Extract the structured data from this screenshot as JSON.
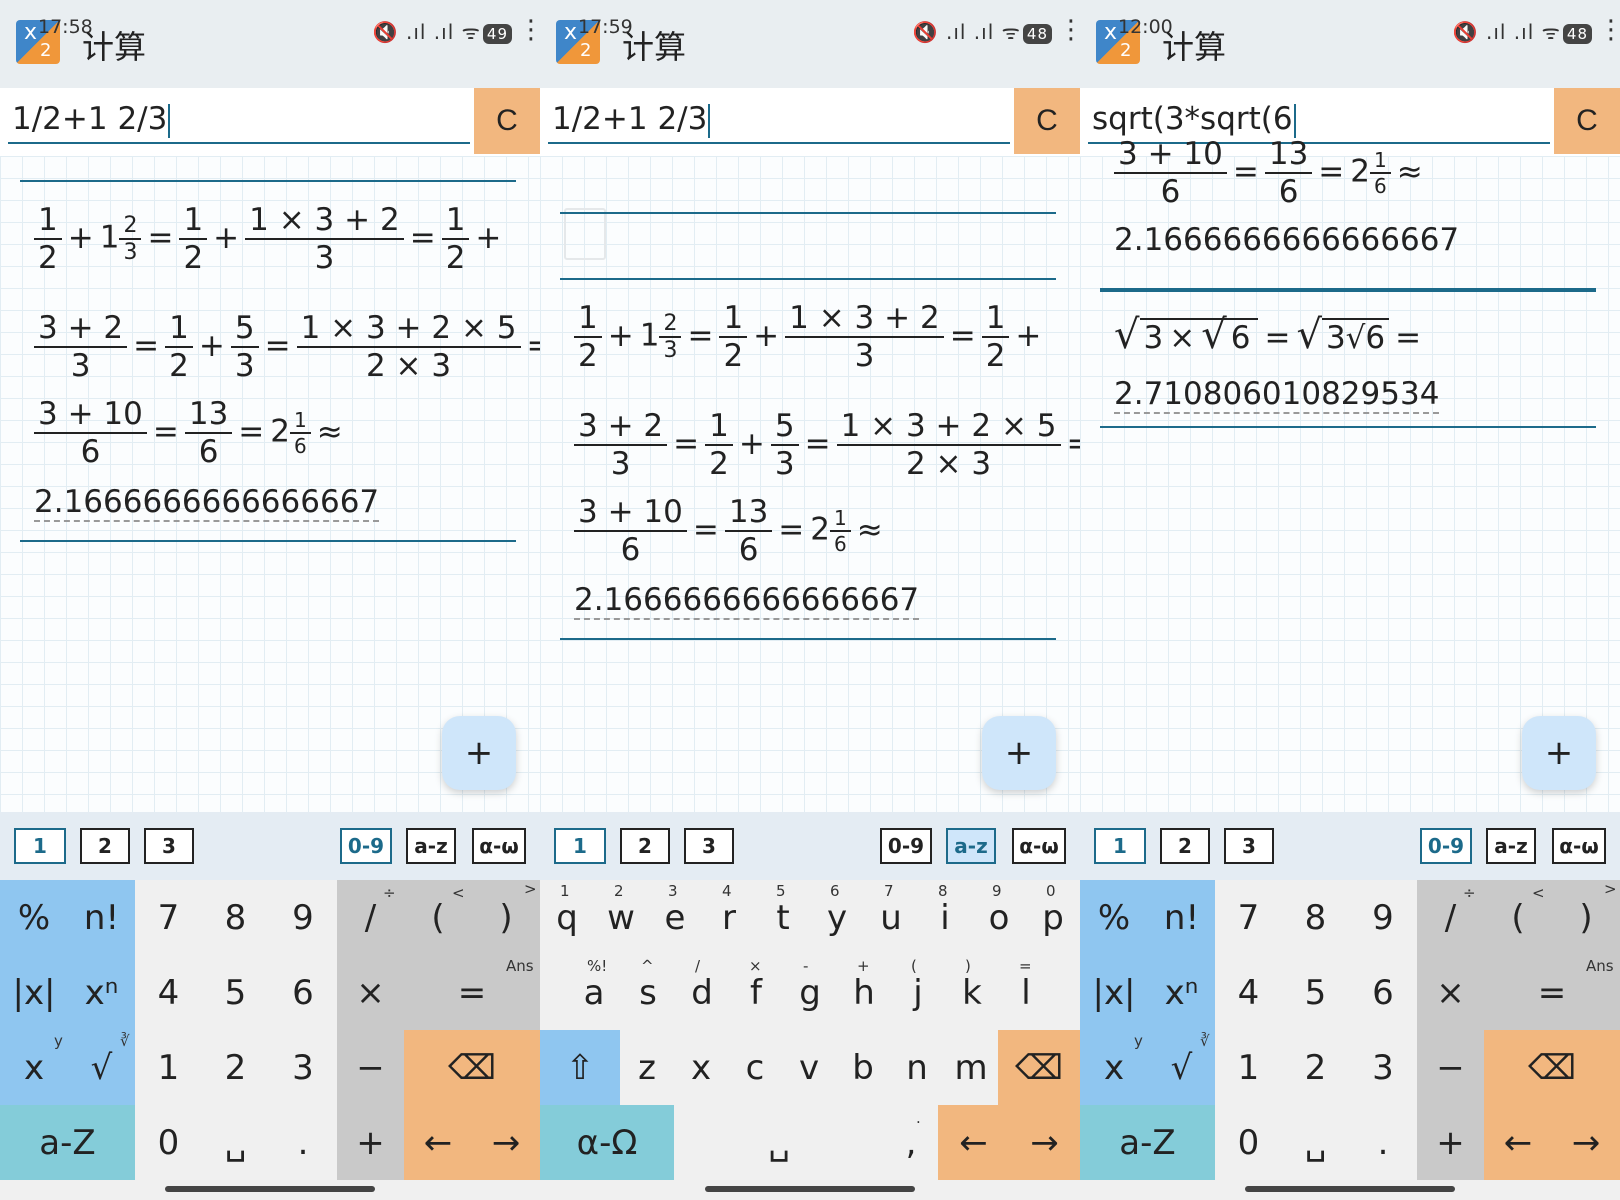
{
  "app": {
    "title": "计算",
    "icon_label_a": "x",
    "icon_label_b": "2"
  },
  "status": {
    "battery_1": "49",
    "battery_2": "48",
    "battery_3": "48",
    "time_1": "17:58",
    "time_2": "17:59",
    "time_3": "12:00",
    "icons": "🔇 .ıl .ıl ᯤ"
  },
  "clear_label": "C",
  "fab_label": "+",
  "panels": [
    {
      "input": "1/2+1 2/3",
      "decimal": "2.1666666666666667"
    },
    {
      "input": "1/2+1 2/3",
      "decimal": "2.1666666666666667"
    },
    {
      "input": "sqrt(3*sqrt(6",
      "decimal_top": "2.1666666666666667",
      "decimal": "2.710806010829534"
    }
  ],
  "math": {
    "n1": "1",
    "n2": "2",
    "n3": "3",
    "n5": "5",
    "n6": "6",
    "n10": "10",
    "n13": "13",
    "plus": "+",
    "eq": "=",
    "approx": "≈",
    "times": "×",
    "mixed_whole": "1",
    "mixed_result_whole": "2",
    "expr_1x3p2": "1 × 3 + 2",
    "expr_3p2": "3 + 2",
    "expr_1x3p2x5": "1 × 3 + 2 × 5",
    "expr_2x3": "2 × 3",
    "expr_3p10": "3 + 10",
    "expr_partial_top": "3 + 10",
    "sqrt_sym": "√",
    "sqrt_inner_left": "3",
    "sqrt_inner_right": "6",
    "sqrt_simplified": "3√6"
  },
  "tabs": {
    "t1": "1",
    "t2": "2",
    "t3": "3",
    "digits": "0-9",
    "latin": "a-z",
    "greek": "α-ω"
  },
  "numpad": {
    "percent": "%",
    "factorial": "n!",
    "abs": "|x|",
    "power": "xⁿ",
    "x": "x",
    "y": "y",
    "root_index": "∛",
    "sqrt": "√",
    "k7": "7",
    "k8": "8",
    "k9": "9",
    "k4": "4",
    "k5": "5",
    "k6": "6",
    "k1": "1",
    "k2": "2",
    "k3": "3",
    "k0": "0",
    "space": "␣",
    "dot": ".",
    "divide": "/",
    "divide_alt": "÷",
    "lparen": "(",
    "lparen_alt": "<",
    "rparen": ")",
    "rparen_alt": ">",
    "multiply": "×",
    "equals": "=",
    "ans": "Ans",
    "minus": "−",
    "plus": "+",
    "backspace": "⌫",
    "left": "←",
    "right": "→",
    "alpha_toggle": "a-Z"
  },
  "qwerty": {
    "row1": [
      "q",
      "w",
      "e",
      "r",
      "t",
      "y",
      "u",
      "i",
      "o",
      "p"
    ],
    "row1_alt": [
      "1",
      "2",
      "3",
      "4",
      "5",
      "6",
      "7",
      "8",
      "9",
      "0"
    ],
    "row2": [
      "a",
      "s",
      "d",
      "f",
      "g",
      "h",
      "j",
      "k",
      "l"
    ],
    "row2_alt": [
      "%!",
      "^",
      "/",
      "×",
      "-",
      "+",
      "(",
      ")",
      "="
    ],
    "row3": [
      "z",
      "x",
      "c",
      "v",
      "b",
      "n",
      "m"
    ],
    "shift": "⇧",
    "greek_toggle": "α-Ω",
    "comma": ",",
    "comma_alt": "."
  }
}
